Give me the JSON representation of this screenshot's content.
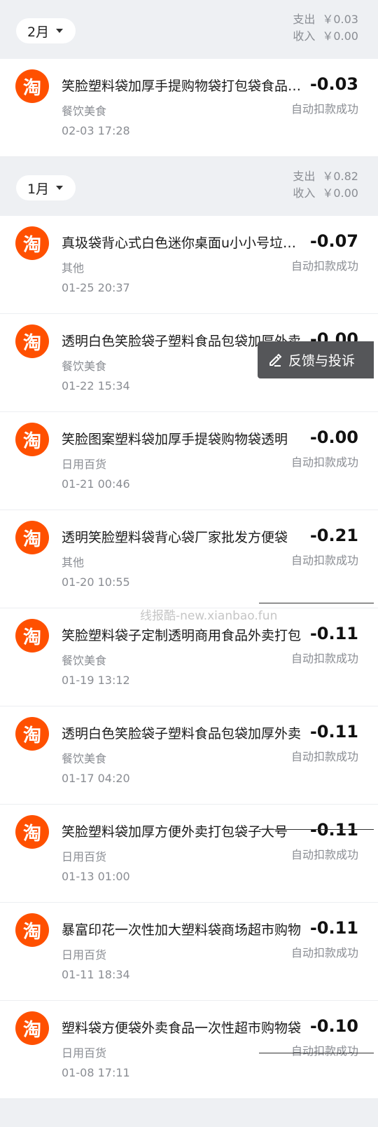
{
  "logo_char": "淘",
  "months": [
    {
      "label": "2月",
      "expense_label": "支出",
      "expense": "￥0.03",
      "income_label": "收入",
      "income": "￥0.00",
      "transactions": [
        {
          "title": "笑脸塑料袋加厚手提购物袋打包袋食品外卖",
          "amount": "-0.03",
          "category": "餐饮美食",
          "status": "自动扣款成功",
          "time": "02-03 17:28"
        }
      ]
    },
    {
      "label": "1月",
      "expense_label": "支出",
      "expense": "￥0.82",
      "income_label": "收入",
      "income": "￥0.00",
      "transactions": [
        {
          "title": "真圾袋背心式白色迷你桌面u小小号垃圾袋",
          "amount": "-0.07",
          "category": "其他",
          "status": "自动扣款成功",
          "time": "01-25 20:37"
        },
        {
          "title": "透明白色笑脸袋子塑料食品包袋加厚外卖",
          "amount": "-0.00",
          "category": "餐饮美食",
          "status": "自动扣款成功",
          "time": "01-22 15:34"
        },
        {
          "title": "笑脸图案塑料袋加厚手提袋购物袋透明",
          "amount": "-0.00",
          "category": "日用百货",
          "status": "自动扣款成功",
          "time": "01-21 00:46"
        },
        {
          "title": "透明笑脸塑料袋背心袋厂家批发方便袋",
          "amount": "-0.21",
          "category": "其他",
          "status": "自动扣款成功",
          "time": "01-20 10:55"
        },
        {
          "title": "笑脸塑料袋子定制透明商用食品外卖打包",
          "amount": "-0.11",
          "category": "餐饮美食",
          "status": "自动扣款成功",
          "time": "01-19 13:12"
        },
        {
          "title": "透明白色笑脸袋子塑料食品包袋加厚外卖",
          "amount": "-0.11",
          "category": "餐饮美食",
          "status": "自动扣款成功",
          "time": "01-17 04:20"
        },
        {
          "title": "笑脸塑料袋加厚方便外卖打包袋子大号",
          "amount": "-0.11",
          "category": "日用百货",
          "status": "自动扣款成功",
          "time": "01-13 01:00"
        },
        {
          "title": "暴富印花一次性加大塑料袋商场超市购物",
          "amount": "-0.11",
          "category": "日用百货",
          "status": "自动扣款成功",
          "time": "01-11 18:34"
        },
        {
          "title": "塑料袋方便袋外卖食品一次性超市购物袋",
          "amount": "-0.10",
          "category": "日用百货",
          "status": "自动扣款成功",
          "time": "01-08 17:11"
        }
      ]
    }
  ],
  "feedback_button": "反馈与投诉",
  "watermark": "线报酷-new.xianbao.fun"
}
